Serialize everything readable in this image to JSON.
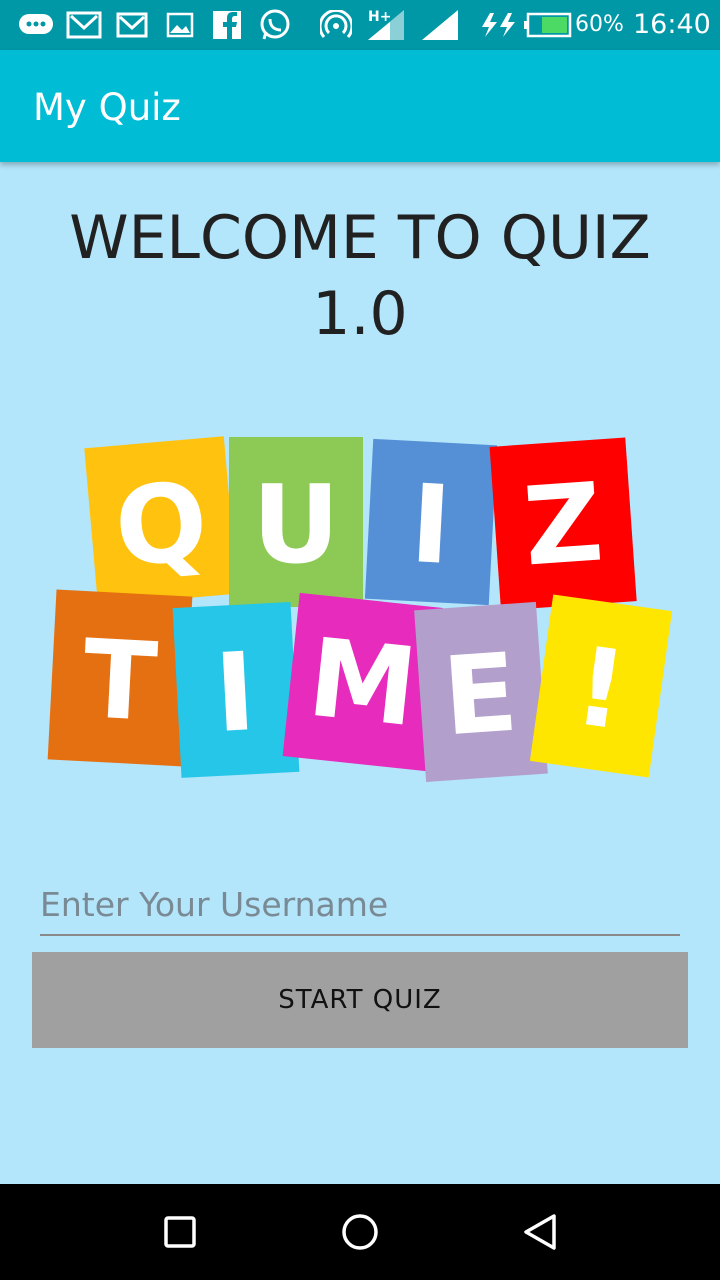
{
  "status_bar": {
    "battery": "60%",
    "time": "16:40",
    "network": "H+",
    "icons": [
      "messages-icon",
      "gmail-icon",
      "gmail-icon",
      "gallery-icon",
      "facebook-icon",
      "whatsapp-icon",
      "hotspot-icon",
      "signal-icon",
      "signal-icon",
      "charging-icon",
      "battery-icon"
    ]
  },
  "app_bar": {
    "title": "My Quiz"
  },
  "main": {
    "welcome_line1": "WELCOME TO QUIZ",
    "welcome_line2": "1.0",
    "logo": {
      "tiles_top": [
        {
          "letter": "Q",
          "color": "#ffc20e"
        },
        {
          "letter": "U",
          "color": "#8dc955"
        },
        {
          "letter": "I",
          "color": "#5590d6"
        },
        {
          "letter": "Z",
          "color": "#ff0000"
        }
      ],
      "tiles_bottom": [
        {
          "letter": "T",
          "color": "#e57011"
        },
        {
          "letter": "I",
          "color": "#26c6e8"
        },
        {
          "letter": "M",
          "color": "#e62bbd"
        },
        {
          "letter": "E",
          "color": "#b39fcc"
        },
        {
          "letter": "!",
          "color": "#ffe600"
        }
      ]
    },
    "username_placeholder": "Enter Your Username",
    "username_value": "",
    "start_button": "START QUIZ"
  },
  "colors": {
    "status_bar": "#0097a7",
    "app_bar": "#00bcd4",
    "background": "#b3e5fb",
    "button": "#a0a0a0"
  }
}
